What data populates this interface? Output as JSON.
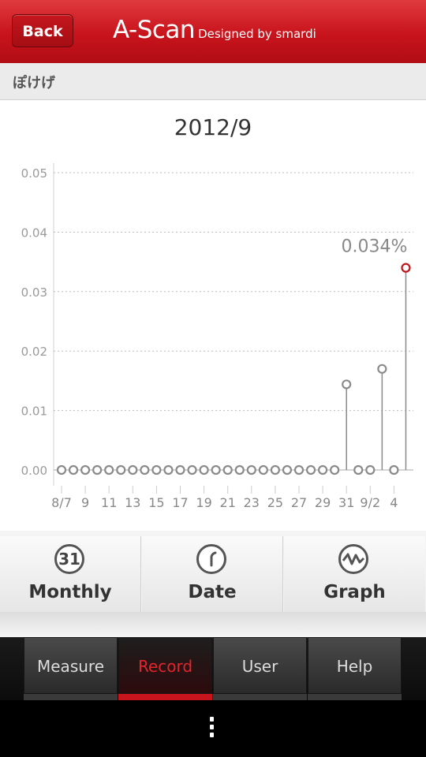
{
  "header": {
    "back_label": "Back",
    "app_name": "A-Scan",
    "app_subtitle": "Designed by smardi"
  },
  "user": {
    "name": "ぽけげ"
  },
  "chart_data": {
    "type": "scatter",
    "title": "2012/9",
    "annotation": "0.034%",
    "y_ticks": [
      "0.05",
      "0.04",
      "0.03",
      "0.02",
      "0.01",
      "0.00"
    ],
    "ylim": [
      0,
      0.05
    ],
    "x_tick_labels": [
      "8/7",
      "9",
      "11",
      "13",
      "15",
      "17",
      "19",
      "21",
      "23",
      "25",
      "27",
      "29",
      "31",
      "9/2",
      "4"
    ],
    "x_tick_index": [
      0,
      2,
      4,
      6,
      8,
      10,
      12,
      14,
      16,
      18,
      20,
      22,
      24,
      26,
      28
    ],
    "points": [
      {
        "i": 0,
        "y": 0
      },
      {
        "i": 1,
        "y": 0
      },
      {
        "i": 2,
        "y": 0
      },
      {
        "i": 3,
        "y": 0
      },
      {
        "i": 4,
        "y": 0
      },
      {
        "i": 5,
        "y": 0
      },
      {
        "i": 6,
        "y": 0
      },
      {
        "i": 7,
        "y": 0
      },
      {
        "i": 8,
        "y": 0
      },
      {
        "i": 9,
        "y": 0
      },
      {
        "i": 10,
        "y": 0
      },
      {
        "i": 11,
        "y": 0
      },
      {
        "i": 12,
        "y": 0
      },
      {
        "i": 13,
        "y": 0
      },
      {
        "i": 14,
        "y": 0
      },
      {
        "i": 15,
        "y": 0
      },
      {
        "i": 16,
        "y": 0
      },
      {
        "i": 17,
        "y": 0
      },
      {
        "i": 18,
        "y": 0
      },
      {
        "i": 19,
        "y": 0
      },
      {
        "i": 20,
        "y": 0
      },
      {
        "i": 21,
        "y": 0
      },
      {
        "i": 22,
        "y": 0
      },
      {
        "i": 23,
        "y": 0
      },
      {
        "i": 24,
        "y": 0.0144
      },
      {
        "i": 25,
        "y": 0
      },
      {
        "i": 26,
        "y": 0
      },
      {
        "i": 27,
        "y": 0.017
      },
      {
        "i": 28,
        "y": 0
      },
      {
        "i": 29,
        "y": 0.034,
        "highlight": true
      }
    ],
    "grid": true,
    "colors": {
      "point": "#8a8a8a",
      "highlight": "#c0141b",
      "grid": "#bdbdbd"
    }
  },
  "view_tabs": [
    {
      "icon": "calendar-icon",
      "icon_text": "31",
      "label": "Monthly"
    },
    {
      "icon": "clock-icon",
      "icon_text": "",
      "label": "Date"
    },
    {
      "icon": "graph-icon",
      "icon_text": "",
      "label": "Graph"
    }
  ],
  "nav": {
    "items": [
      {
        "label": "Measure",
        "active": false
      },
      {
        "label": "Record",
        "active": true
      },
      {
        "label": "User",
        "active": false
      },
      {
        "label": "Help",
        "active": false
      }
    ]
  },
  "colors": {
    "brand": "#c8131b",
    "active_tab": "#e5232a"
  }
}
